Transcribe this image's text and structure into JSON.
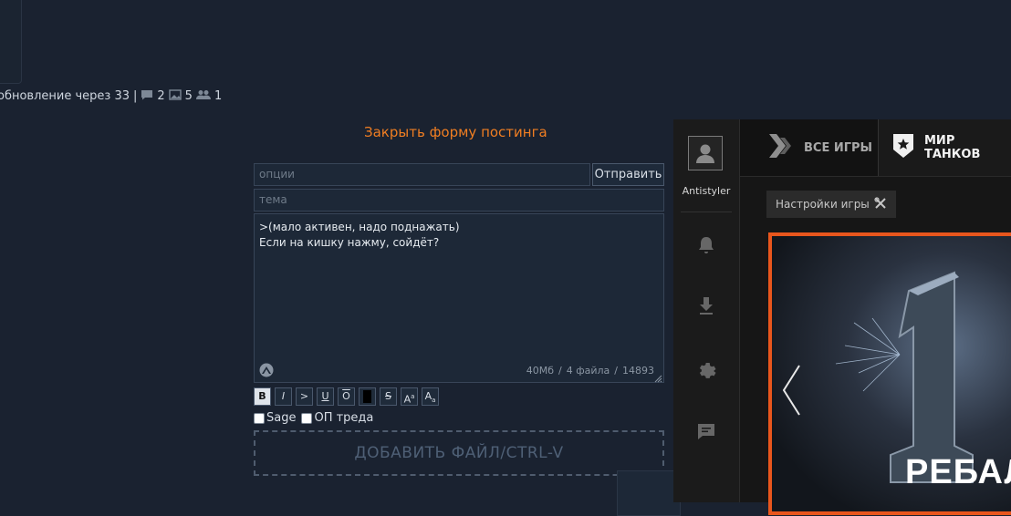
{
  "status": {
    "refresh_text": "обновление через 33",
    "separator": "|",
    "replies_count": "2",
    "images_count": "5",
    "posters_count": "1"
  },
  "form": {
    "close_label": "Закрыть форму постинга",
    "options_placeholder": "опции",
    "subject_placeholder": "тема",
    "send_label": "Отправить",
    "message_lines": [
      ">(мало активен, надо поднажать)",
      "Если на кишку нажму, сойдёт?"
    ],
    "limit_size": "40Мб",
    "limit_files": "4 файла",
    "limit_chars": "14893",
    "counter_sep": "/",
    "format_buttons": [
      "B",
      "I",
      ">",
      "U",
      "O",
      "",
      "S",
      "Aa",
      "Aa"
    ],
    "sage_label": "Sage",
    "op_label": "ОП треда",
    "dropzone_label": "ДОБАВИТЬ ФАЙЛ/CTRL-V"
  },
  "overlay": {
    "username": "Antistyler",
    "tab_all_games": "ВСЕ ИГРЫ",
    "tab_game": "МИР ТАНКОВ",
    "game_settings_label": "Настройки игры",
    "banner_text": "РЕБАЛ",
    "accent_color": "#e8561d"
  }
}
